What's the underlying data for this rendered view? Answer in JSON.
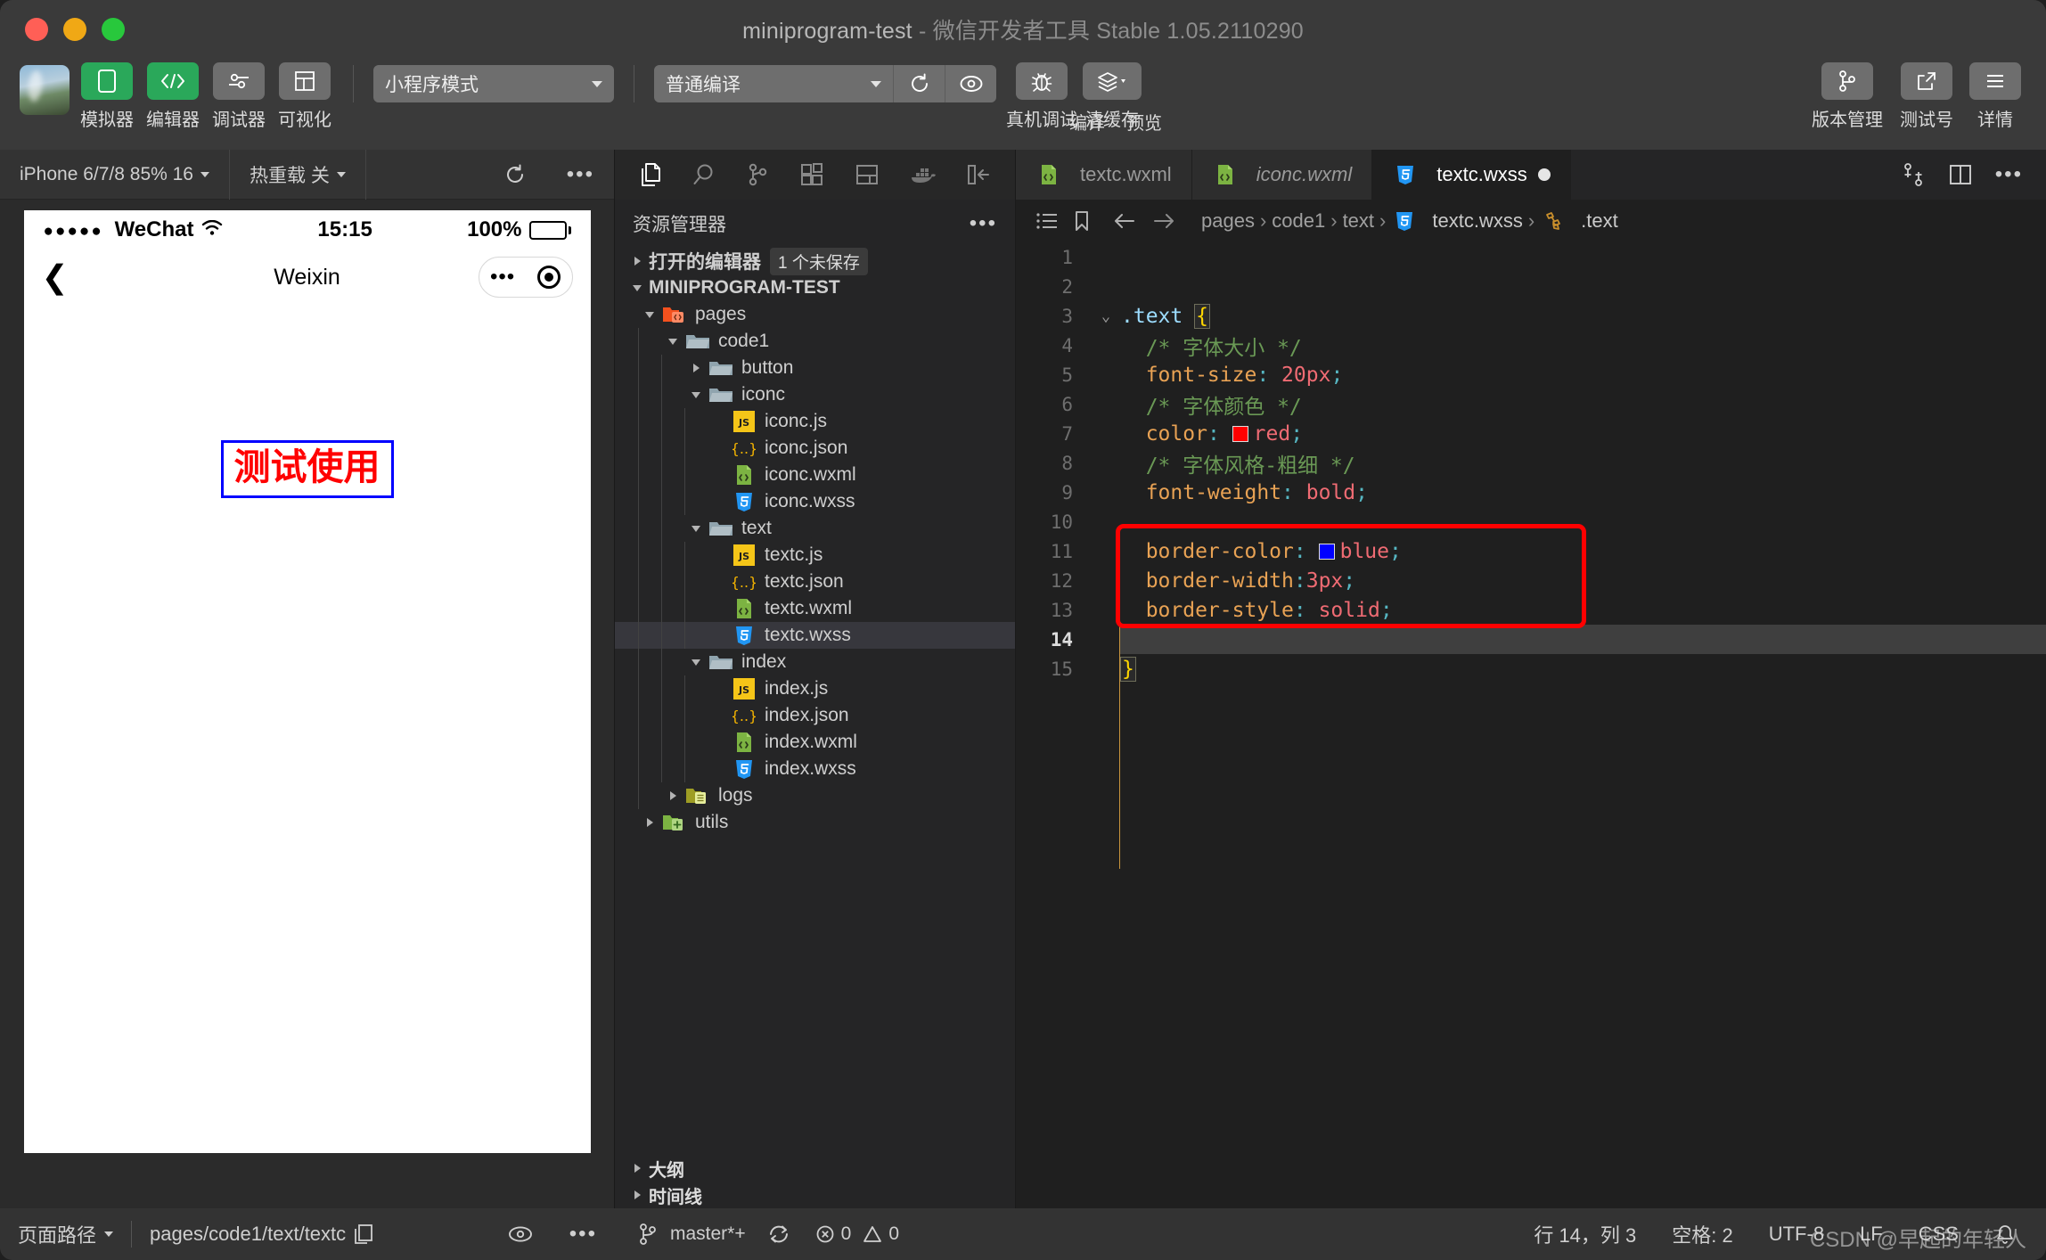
{
  "window": {
    "title_main": "miniprogram-test",
    "title_sub": " - 微信开发者工具 Stable 1.05.2110290"
  },
  "toolbar": {
    "buttons": [
      {
        "label": "模拟器",
        "icon": "phone-icon",
        "accent": "green"
      },
      {
        "label": "编辑器",
        "icon": "code-icon",
        "accent": "green"
      },
      {
        "label": "调试器",
        "icon": "slider-icon",
        "accent": "grey"
      },
      {
        "label": "可视化",
        "icon": "layout-icon",
        "accent": "grey"
      }
    ],
    "mode_select": "小程序模式",
    "compile_select": "普通编译",
    "actions": [
      {
        "label": "编译",
        "icon": "refresh-icon"
      },
      {
        "label": "预览",
        "icon": "eye-icon"
      },
      {
        "label": "真机调试",
        "icon": "bug-icon"
      },
      {
        "label": "清缓存",
        "icon": "layers-icon"
      }
    ],
    "right_actions": [
      {
        "label": "版本管理",
        "icon": "branch-icon"
      },
      {
        "label": "测试号",
        "icon": "external-link-icon"
      },
      {
        "label": "详情",
        "icon": "menu-icon"
      }
    ]
  },
  "simulator": {
    "device": "iPhone 6/7/8 85% 16",
    "hot_reload": "热重载 关",
    "refresh_icon": "refresh-icon",
    "more_icon": "more-icon",
    "phone": {
      "carrier": "WeChat",
      "signal_dots": "●●●●●",
      "time": "15:15",
      "battery_percent": "100%",
      "nav_title": "Weixin",
      "back_icon": "chevron-left-icon",
      "capsule_dots": "•••",
      "content_text": "测试使用",
      "content_color": "#ff0000",
      "content_border_color": "#0000ff",
      "content_border_width": "3px"
    },
    "footer": {
      "page_path_label": "页面路径",
      "page_path_value": "pages/code1/text/textc",
      "copy_icon": "copy-icon",
      "eye_icon": "eye-icon",
      "more_icon": "more-icon"
    }
  },
  "explorer": {
    "activity_icons": [
      "files-icon",
      "search-icon",
      "source-control-icon",
      "extensions-icon",
      "debug-console-icon",
      "docker-icon",
      "collapse-panel-icon"
    ],
    "header": "资源管理器",
    "header_more": "more-icon",
    "open_editors": {
      "label": "打开的编辑器",
      "badge": "1 个未保存"
    },
    "project_name": "MINIPROGRAM-TEST",
    "tree": [
      {
        "depth": 1,
        "label": "pages",
        "type": "folder",
        "icon": "folder-pages-icon",
        "state": "open",
        "selected": false
      },
      {
        "depth": 2,
        "label": "code1",
        "type": "folder",
        "icon": "folder-icon",
        "state": "open",
        "selected": false
      },
      {
        "depth": 3,
        "label": "button",
        "type": "folder",
        "icon": "folder-icon",
        "state": "closed",
        "selected": false
      },
      {
        "depth": 3,
        "label": "iconc",
        "type": "folder",
        "icon": "folder-icon",
        "state": "open",
        "selected": false
      },
      {
        "depth": 4,
        "label": "iconc.js",
        "type": "file",
        "icon": "js-icon",
        "state": "",
        "selected": false
      },
      {
        "depth": 4,
        "label": "iconc.json",
        "type": "file",
        "icon": "json-icon",
        "state": "",
        "selected": false
      },
      {
        "depth": 4,
        "label": "iconc.wxml",
        "type": "file",
        "icon": "wxml-icon",
        "state": "",
        "selected": false
      },
      {
        "depth": 4,
        "label": "iconc.wxss",
        "type": "file",
        "icon": "wxss-icon",
        "state": "",
        "selected": false
      },
      {
        "depth": 3,
        "label": "text",
        "type": "folder",
        "icon": "folder-icon",
        "state": "open",
        "selected": false
      },
      {
        "depth": 4,
        "label": "textc.js",
        "type": "file",
        "icon": "js-icon",
        "state": "",
        "selected": false
      },
      {
        "depth": 4,
        "label": "textc.json",
        "type": "file",
        "icon": "json-icon",
        "state": "",
        "selected": false
      },
      {
        "depth": 4,
        "label": "textc.wxml",
        "type": "file",
        "icon": "wxml-icon",
        "state": "",
        "selected": false
      },
      {
        "depth": 4,
        "label": "textc.wxss",
        "type": "file",
        "icon": "wxss-icon",
        "state": "",
        "selected": true
      },
      {
        "depth": 3,
        "label": "index",
        "type": "folder",
        "icon": "folder-icon",
        "state": "open",
        "selected": false
      },
      {
        "depth": 4,
        "label": "index.js",
        "type": "file",
        "icon": "js-icon",
        "state": "",
        "selected": false
      },
      {
        "depth": 4,
        "label": "index.json",
        "type": "file",
        "icon": "json-icon",
        "state": "",
        "selected": false
      },
      {
        "depth": 4,
        "label": "index.wxml",
        "type": "file",
        "icon": "wxml-icon",
        "state": "",
        "selected": false
      },
      {
        "depth": 4,
        "label": "index.wxss",
        "type": "file",
        "icon": "wxss-icon",
        "state": "",
        "selected": false
      },
      {
        "depth": 2,
        "label": "logs",
        "type": "folder",
        "icon": "folder-logs-icon",
        "state": "closed",
        "selected": false
      },
      {
        "depth": 1,
        "label": "utils",
        "type": "folder",
        "icon": "folder-utils-icon",
        "state": "closed",
        "selected": false
      }
    ],
    "outline": "大纲",
    "timeline": "时间线",
    "scm": {
      "branch": "master*+",
      "sync_icon": "sync-icon",
      "errors": "0",
      "warnings": "0"
    }
  },
  "editor": {
    "tabs": [
      {
        "label": "textc.wxml",
        "icon": "wxml-icon",
        "active": false,
        "italic": false,
        "modified": false
      },
      {
        "label": "iconc.wxml",
        "icon": "wxml-icon",
        "active": false,
        "italic": true,
        "modified": false
      },
      {
        "label": "textc.wxss",
        "icon": "wxss-icon",
        "active": true,
        "italic": false,
        "modified": true
      }
    ],
    "tab_actions": [
      "split-diff-icon",
      "split-editor-icon",
      "more-icon"
    ],
    "breadcrumb_icons": [
      "outline-list-icon",
      "bookmark-icon",
      "arrow-left-icon",
      "arrow-right-icon"
    ],
    "breadcrumb": [
      {
        "label": "pages",
        "icon": ""
      },
      {
        "label": "code1",
        "icon": ""
      },
      {
        "label": "text",
        "icon": ""
      },
      {
        "label": "textc.wxss",
        "icon": "wxss-icon"
      },
      {
        "label": ".text",
        "icon": "css-rule-icon"
      }
    ],
    "lines": [
      {
        "n": "1",
        "fold": "",
        "tokens": []
      },
      {
        "n": "2",
        "fold": "",
        "tokens": []
      },
      {
        "n": "3",
        "fold": "v",
        "tokens": [
          {
            "t": ".text ",
            "c": "sel"
          },
          {
            "t": "{",
            "c": "brace-box"
          }
        ]
      },
      {
        "n": "4",
        "fold": "",
        "tokens": [
          {
            "t": "  /* 字体大小 */",
            "c": "com"
          }
        ]
      },
      {
        "n": "5",
        "fold": "",
        "tokens": [
          {
            "t": "  font-size",
            "c": "prop"
          },
          {
            "t": ":",
            "c": "colon"
          },
          {
            "t": " 20px",
            "c": "val"
          },
          {
            "t": ";",
            "c": "punct"
          }
        ]
      },
      {
        "n": "6",
        "fold": "",
        "tokens": [
          {
            "t": "  /* 字体颜色 */",
            "c": "com"
          }
        ]
      },
      {
        "n": "7",
        "fold": "",
        "tokens": [
          {
            "t": "  color",
            "c": "prop"
          },
          {
            "t": ":",
            "c": "colon"
          },
          {
            "t": " ",
            "c": "val"
          },
          {
            "t": "#ff0000",
            "c": "swatch"
          },
          {
            "t": "red",
            "c": "val"
          },
          {
            "t": ";",
            "c": "punct"
          }
        ]
      },
      {
        "n": "8",
        "fold": "",
        "tokens": [
          {
            "t": "  /* 字体风格-粗细 */",
            "c": "com"
          }
        ]
      },
      {
        "n": "9",
        "fold": "",
        "tokens": [
          {
            "t": "  font-weight",
            "c": "prop"
          },
          {
            "t": ":",
            "c": "colon"
          },
          {
            "t": " bold",
            "c": "val"
          },
          {
            "t": ";",
            "c": "punct"
          }
        ]
      },
      {
        "n": "10",
        "fold": "",
        "tokens": []
      },
      {
        "n": "11",
        "fold": "",
        "tokens": [
          {
            "t": "  border-color",
            "c": "prop"
          },
          {
            "t": ":",
            "c": "colon"
          },
          {
            "t": " ",
            "c": "val"
          },
          {
            "t": "#0000ff",
            "c": "swatch"
          },
          {
            "t": "blue",
            "c": "val"
          },
          {
            "t": ";",
            "c": "punct"
          }
        ]
      },
      {
        "n": "12",
        "fold": "",
        "tokens": [
          {
            "t": "  border-width",
            "c": "prop"
          },
          {
            "t": ":",
            "c": "colon"
          },
          {
            "t": "3px",
            "c": "val"
          },
          {
            "t": ";",
            "c": "punct"
          }
        ]
      },
      {
        "n": "13",
        "fold": "",
        "tokens": [
          {
            "t": "  border-style",
            "c": "prop"
          },
          {
            "t": ":",
            "c": "colon"
          },
          {
            "t": " solid",
            "c": "val"
          },
          {
            "t": ";",
            "c": "punct"
          }
        ]
      },
      {
        "n": "14",
        "fold": "",
        "tokens": [],
        "current": true
      },
      {
        "n": "15",
        "fold": "",
        "tokens": [
          {
            "t": "}",
            "c": "brace-box"
          }
        ]
      }
    ],
    "highlight_color": "#ff0000"
  },
  "statusbar": {
    "cursor": "行 14，列 3",
    "spaces": "空格: 2",
    "encoding": "UTF-8",
    "eol": "LF",
    "language": "CSS",
    "bell_icon": "bell-icon",
    "watermark": "CSDN @早起的年轻人"
  }
}
